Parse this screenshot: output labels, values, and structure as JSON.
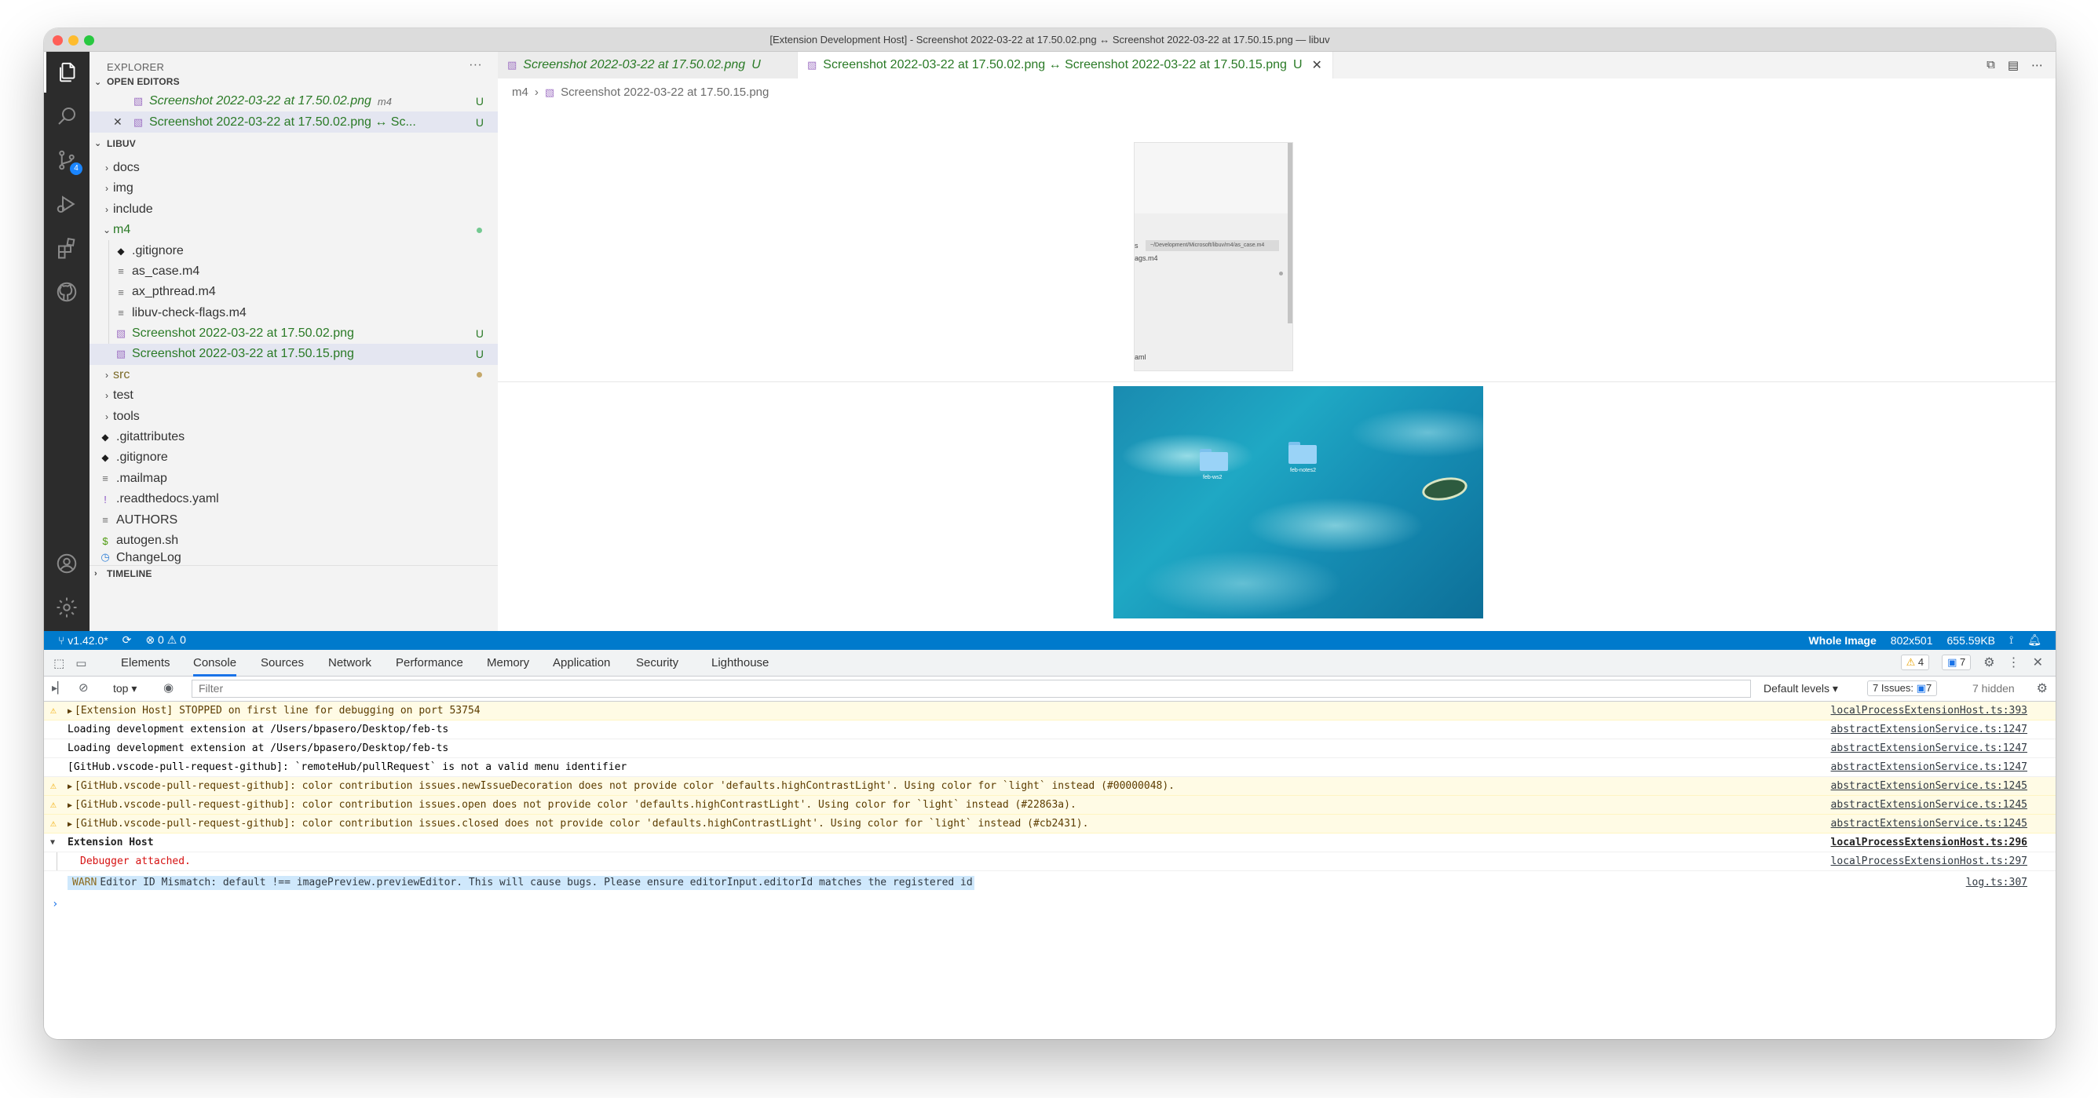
{
  "window": {
    "title": "[Extension Development Host] - Screenshot 2022-03-22 at 17.50.02.png ↔ Screenshot 2022-03-22 at 17.50.15.png — libuv"
  },
  "activity_bar": {
    "source_control_badge": "4",
    "items": [
      "explorer-icon",
      "search-icon",
      "source-control-icon",
      "run-debug-icon",
      "extensions-icon",
      "github-icon",
      "account-icon",
      "settings-gear-icon"
    ]
  },
  "sidebar": {
    "header": "EXPLORER",
    "more": "···",
    "open_editors_title": "OPEN EDITORS",
    "open_editors": [
      {
        "label": "Screenshot 2022-03-22 at 17.50.02.png",
        "desc": "m4",
        "deco": "U"
      },
      {
        "label": "Screenshot 2022-03-22 at 17.50.02.png ↔ Sc...",
        "deco": "U",
        "close": "✕"
      }
    ],
    "project_title": "LIBUV",
    "tree": [
      {
        "label": "docs",
        "type": "folder"
      },
      {
        "label": "img",
        "type": "folder"
      },
      {
        "label": "include",
        "type": "folder"
      },
      {
        "label": "m4",
        "type": "folder-open"
      },
      {
        "label": ".gitignore",
        "type": "git"
      },
      {
        "label": "as_case.m4",
        "type": "file"
      },
      {
        "label": "ax_pthread.m4",
        "type": "file"
      },
      {
        "label": "libuv-check-flags.m4",
        "type": "file"
      },
      {
        "label": "Screenshot 2022-03-22 at 17.50.02.png",
        "type": "image",
        "deco": "U"
      },
      {
        "label": "Screenshot 2022-03-22 at 17.50.15.png",
        "type": "image",
        "deco": "U"
      },
      {
        "label": "src",
        "type": "folder"
      },
      {
        "label": "test",
        "type": "folder"
      },
      {
        "label": "tools",
        "type": "folder"
      },
      {
        "label": ".gitattributes",
        "type": "git"
      },
      {
        "label": ".gitignore",
        "type": "git"
      },
      {
        "label": ".mailmap",
        "type": "file"
      },
      {
        "label": ".readthedocs.yaml",
        "type": "yaml"
      },
      {
        "label": "AUTHORS",
        "type": "file"
      },
      {
        "label": "autogen.sh",
        "type": "sh"
      },
      {
        "label": "ChangeLog",
        "type": "log"
      }
    ],
    "timeline_title": "TIMELINE"
  },
  "editor": {
    "tabs": [
      {
        "label": "Screenshot 2022-03-22 at 17.50.02.png",
        "deco": "U"
      },
      {
        "label": "Screenshot 2022-03-22 at 17.50.02.png ↔ Screenshot 2022-03-22 at 17.50.15.png",
        "deco": "U",
        "close": "✕"
      }
    ],
    "breadcrumb": [
      "m4",
      "Screenshot 2022-03-22 at 17.50.15.png"
    ],
    "preview_top": {
      "path": "~/Development/Microsoft/libuv/m4/as_case.m4",
      "line1": "s",
      "line2": "ags.m4",
      "line3": "aml"
    },
    "preview_bottom": {
      "folder1": "feb-ws2",
      "folder2": "feb-notes2"
    }
  },
  "statusbar": {
    "branch": "v1.42.0*",
    "sync": "⟳",
    "problems": "⊗ 0 ⚠ 0",
    "zoom": "Whole Image",
    "dimensions": "802x501",
    "size": "655.59KB"
  },
  "devtools": {
    "tabs": [
      "Elements",
      "Console",
      "Sources",
      "Network",
      "Performance",
      "Memory",
      "Application",
      "Security",
      "Lighthouse"
    ],
    "active_tab": "Console",
    "warn_count": "4",
    "msg_count": "7",
    "context": "top",
    "filter_placeholder": "Filter",
    "levels": "Default levels",
    "issues_label": "7 Issues:",
    "issues_count": "7",
    "hidden": "7 hidden",
    "messages": [
      {
        "level": "warn",
        "expand": true,
        "text": "[Extension Host] STOPPED on first line for debugging on port 53754",
        "source": "localProcessExtensionHost.ts:393"
      },
      {
        "level": "info",
        "text": "Loading development extension at /Users/bpasero/Desktop/feb-ts",
        "source": "abstractExtensionService.ts:1247"
      },
      {
        "level": "info",
        "text": "Loading development extension at /Users/bpasero/Desktop/feb-ts",
        "source": "abstractExtensionService.ts:1247"
      },
      {
        "level": "info",
        "text": "[GitHub.vscode-pull-request-github]: `remoteHub/pullRequest` is not a valid menu identifier",
        "source": "abstractExtensionService.ts:1247"
      },
      {
        "level": "warn",
        "expand": true,
        "text": "[GitHub.vscode-pull-request-github]: color contribution issues.newIssueDecoration does not provide color 'defaults.highContrastLight'. Using color for `light` instead (#00000048).",
        "source": "abstractExtensionService.ts:1245"
      },
      {
        "level": "warn",
        "expand": true,
        "text": "[GitHub.vscode-pull-request-github]: color contribution issues.open does not provide color 'defaults.highContrastLight'. Using color for `light` instead (#22863a).",
        "source": "abstractExtensionService.ts:1245"
      },
      {
        "level": "warn",
        "expand": true,
        "text": "[GitHub.vscode-pull-request-github]: color contribution issues.closed does not provide color 'defaults.highContrastLight'. Using color for `light` instead (#cb2431).",
        "source": "abstractExtensionService.ts:1245"
      }
    ],
    "group": {
      "title": "Extension Host",
      "source": "localProcessExtensionHost.ts:296",
      "child": "Debugger attached.",
      "child_source": "localProcessExtensionHost.ts:297"
    },
    "highlight": {
      "tag": "WARN",
      "text": "Editor ID Mismatch: default !== imagePreview.previewEditor. This will cause bugs. Please ensure editorInput.editorId matches the registered id",
      "source": "log.ts:307"
    },
    "prompt": "›"
  }
}
